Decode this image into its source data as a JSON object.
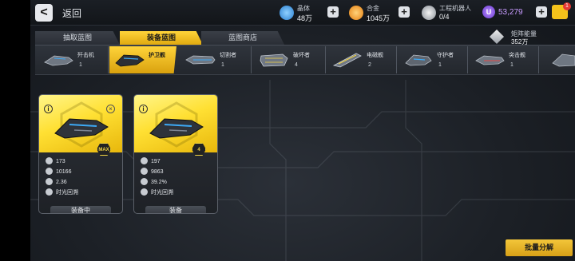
{
  "header": {
    "back_label": "返回",
    "resources": [
      {
        "label": "晶体",
        "value": "48万",
        "icon": "crystal-icon",
        "color": "#3da9f5"
      },
      {
        "label": "合金",
        "value": "1045万",
        "icon": "alloy-icon",
        "color": "#f39c1f"
      },
      {
        "label": "工程机器人",
        "value": "0/4",
        "icon": "robot-icon",
        "color": "#cfd4da"
      }
    ],
    "premium": {
      "icon_letter": "U",
      "value": "53,279",
      "color": "#b98cff"
    },
    "cart_badge": "1"
  },
  "tabs": [
    {
      "label": "抽取蓝图",
      "active": false
    },
    {
      "label": "装备蓝图",
      "active": true
    },
    {
      "label": "蓝图商店",
      "active": false
    }
  ],
  "matrix_energy": {
    "label": "矩阵能量",
    "value": "352万"
  },
  "ship_categories": [
    {
      "name": "歼击机",
      "count": "1",
      "selected": false
    },
    {
      "name": "护卫舰",
      "count": "",
      "selected": true
    },
    {
      "name": "切割者",
      "count": "1",
      "selected": false
    },
    {
      "name": "破坏者",
      "count": "4",
      "selected": false
    },
    {
      "name": "电磁舰",
      "count": "2",
      "selected": false
    },
    {
      "name": "守护者",
      "count": "1",
      "selected": false
    },
    {
      "name": "突击舰",
      "count": "1",
      "selected": false
    }
  ],
  "cards": [
    {
      "grade": "MAX",
      "stat_attack": "173",
      "stat_hp": "10166",
      "stat_third": "2.36",
      "skill": "时光回溯",
      "button": "装备中",
      "has_close": true
    },
    {
      "grade": "4",
      "stat_attack": "197",
      "stat_hp": "9863",
      "stat_third": "39.2%",
      "skill": "时光回溯",
      "button": "装备",
      "has_close": false
    }
  ],
  "batch_button": "批量分解",
  "colors": {
    "accent": "#ffd43a",
    "panel": "#2b3038"
  }
}
